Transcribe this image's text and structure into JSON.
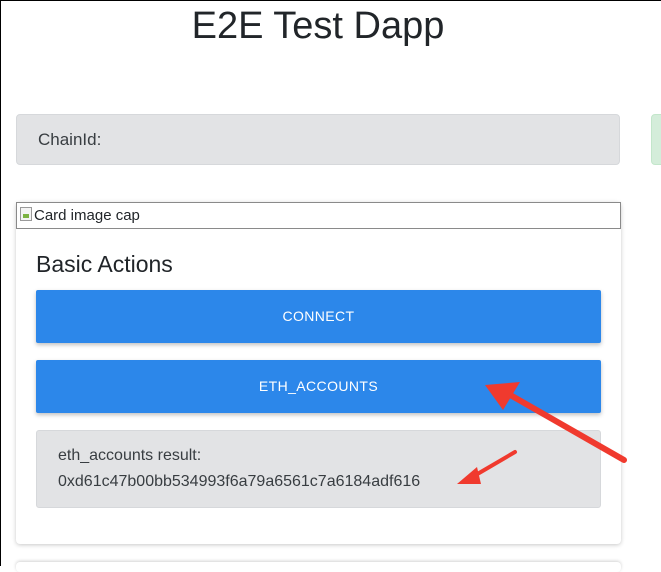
{
  "header": {
    "title": "E2E Test Dapp"
  },
  "network": {
    "chain_id_label": "ChainId:"
  },
  "basic_actions_card": {
    "image_alt": "Card image cap",
    "title": "Basic Actions",
    "connect_button": "CONNECT",
    "eth_accounts_button": "ETH_ACCOUNTS",
    "result_label": "eth_accounts result:",
    "result_value": "0xd61c47b00bb534993f6a79a6561c7a6184adf616"
  },
  "annotations": {
    "arrow_color": "#f03a2e"
  },
  "colors": {
    "button_blue": "#2c87ea",
    "alert_gray": "#e2e3e5",
    "alert_green": "#d4edda"
  }
}
